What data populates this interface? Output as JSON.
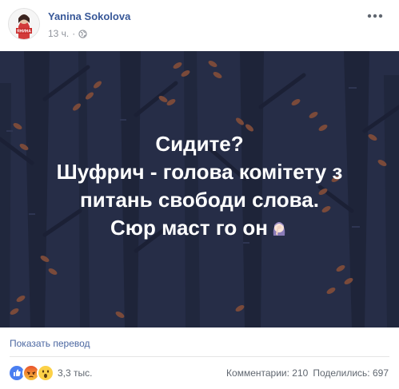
{
  "post": {
    "author": "Yanina Sokolova",
    "time": "13 ч.",
    "separator": "·",
    "privacy_icon": "globe-icon",
    "avatar_text": "ЯНИНА"
  },
  "image": {
    "lines": [
      "Сидите?",
      "Шуфрич - голова комітету з",
      "питань свободи слова.",
      "Сюр маст го он"
    ],
    "emoji_icon": "woman-facepalming-icon",
    "colors": {
      "background": "#262d47",
      "trees": "#1b2035",
      "leaves": "#7a4a3a"
    }
  },
  "footer": {
    "translate_link": "Показать перевод",
    "reaction_icons": [
      "like-icon",
      "angry-icon",
      "wow-icon"
    ],
    "reactions_count": "3,3 тыс.",
    "comments": "Комментарии: 210",
    "shares": "Поделились: 697"
  }
}
